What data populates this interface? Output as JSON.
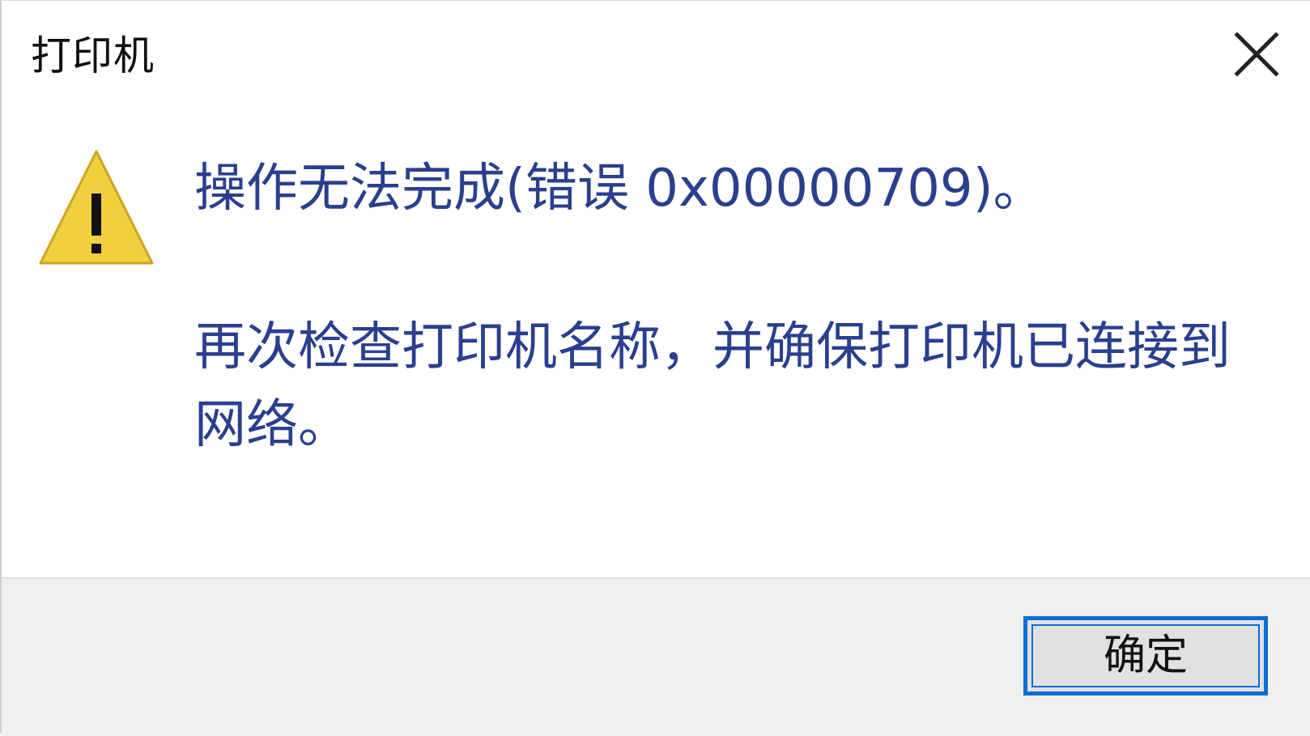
{
  "dialog": {
    "title": "打印机",
    "close_icon": "close-icon",
    "icon": "warning-icon",
    "colors": {
      "message_text": "#2a3f8e",
      "warning_fill": "#f2cf3c",
      "button_border": "#0a6fd6",
      "footer_bg": "#f0f0f0"
    },
    "message_main": "操作无法完成(错误 0x00000709)。",
    "message_sub": "再次检查打印机名称，并确保打印机已连接到网络。",
    "ok_label": "确定"
  }
}
